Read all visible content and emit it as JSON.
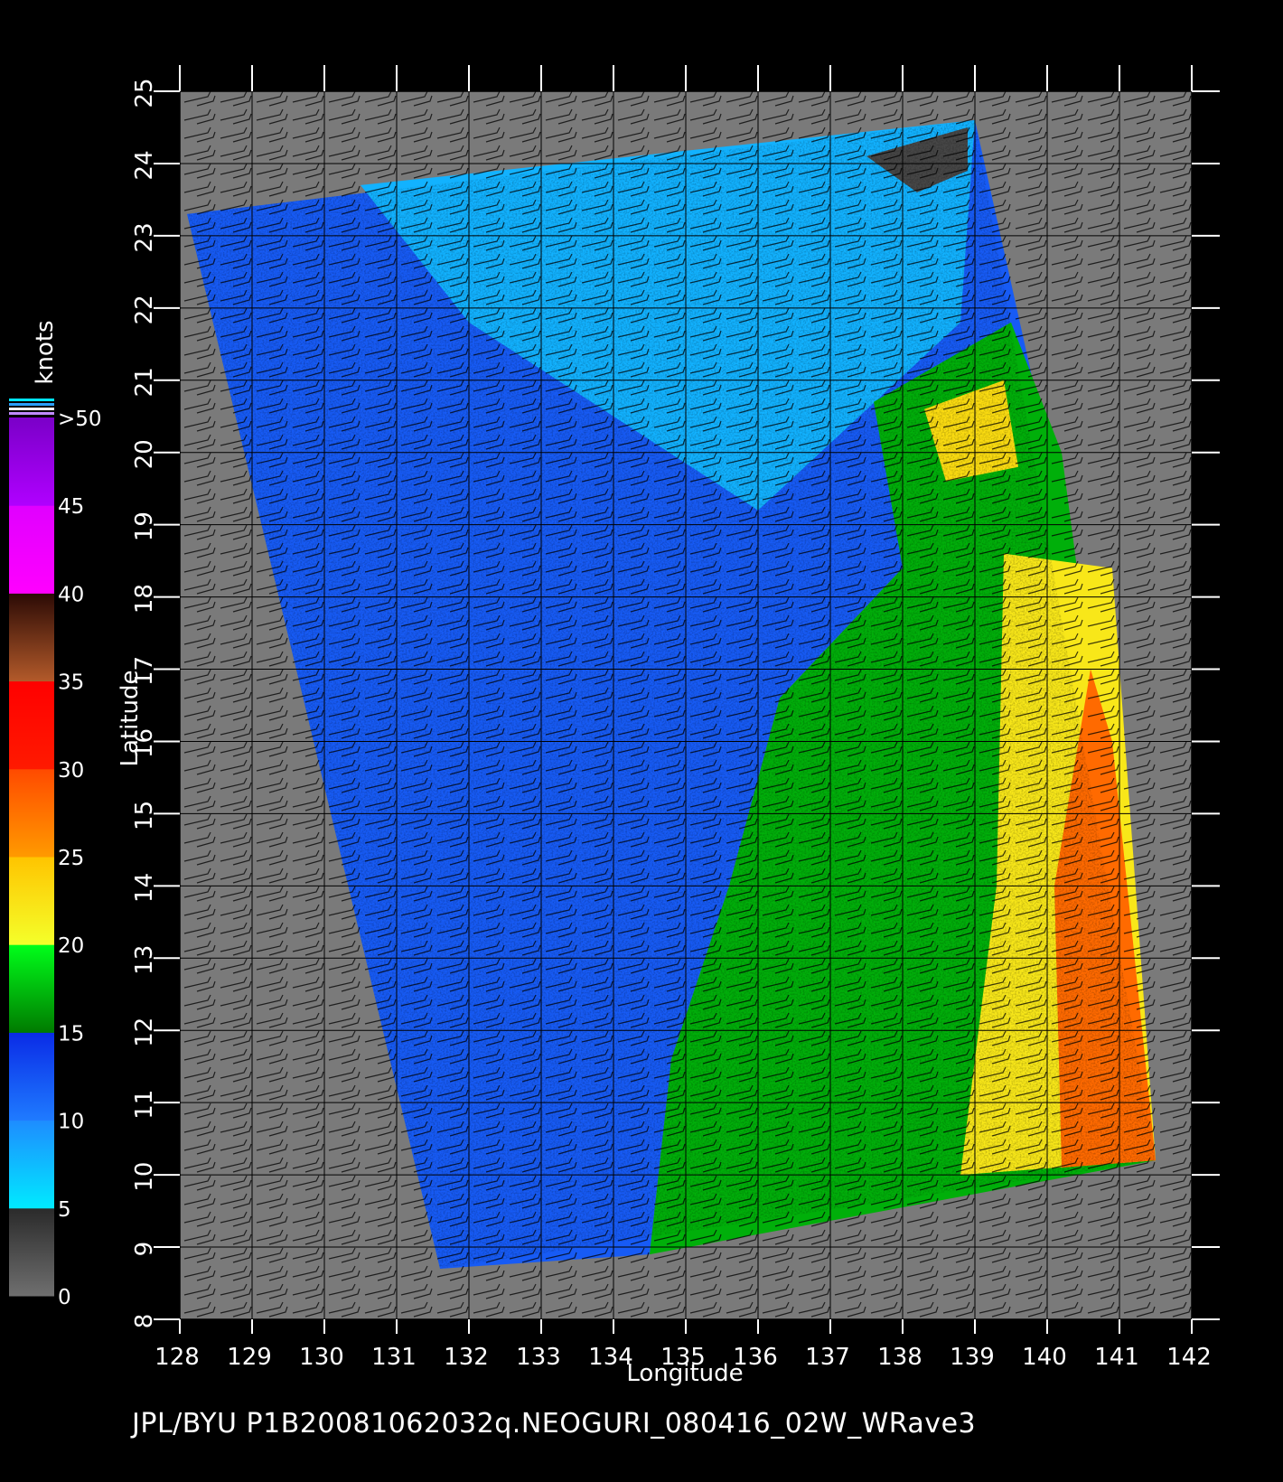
{
  "chart_data": {
    "type": "heatmap",
    "title": "",
    "caption": "JPL/BYU  P1B20081062032q.NEOGURI_080416_02W_WRave3",
    "xlabel": "Longitude",
    "ylabel": "Latitude",
    "xlim": [
      128,
      142
    ],
    "ylim": [
      8,
      25
    ],
    "x_ticks": [
      "128",
      "129",
      "130",
      "131",
      "132",
      "133",
      "134",
      "135",
      "136",
      "137",
      "138",
      "139",
      "140",
      "141",
      "142"
    ],
    "y_ticks": [
      "8",
      "9",
      "10",
      "11",
      "12",
      "13",
      "14",
      "15",
      "16",
      "17",
      "18",
      "19",
      "20",
      "21",
      "22",
      "23",
      "24",
      "25"
    ],
    "grid": true,
    "legend": "colorbar-left",
    "colorbar": {
      "title": "knots",
      "labels": [
        "0",
        "5",
        "10",
        "15",
        "20",
        "25",
        "30",
        "35",
        "40",
        "45",
        ">50"
      ],
      "bins": [
        {
          "range": [
            0,
            5
          ],
          "colors": [
            "#6f6f6f",
            "#2a2a2a"
          ]
        },
        {
          "range": [
            5,
            10
          ],
          "colors": [
            "#00eaff",
            "#1e8cff"
          ]
        },
        {
          "range": [
            10,
            15
          ],
          "colors": [
            "#1f7bff",
            "#0a2be6"
          ]
        },
        {
          "range": [
            15,
            20
          ],
          "colors": [
            "#007a00",
            "#00ff1a"
          ]
        },
        {
          "range": [
            20,
            25
          ],
          "colors": [
            "#f4ff2a",
            "#ffc400"
          ]
        },
        {
          "range": [
            25,
            30
          ],
          "colors": [
            "#ff9a00",
            "#ff4a00"
          ]
        },
        {
          "range": [
            30,
            35
          ],
          "colors": [
            "#ff1a00",
            "#ff0000"
          ]
        },
        {
          "range": [
            35,
            40
          ],
          "colors": [
            "#b35a2a",
            "#2b0a05"
          ]
        },
        {
          "range": [
            40,
            45
          ],
          "colors": [
            "#ff00ff",
            "#e000ff"
          ]
        },
        {
          "range": [
            45,
            50
          ],
          "colors": [
            "#b000ff",
            "#7a00c8"
          ]
        }
      ]
    },
    "swath_corners_lonlat": [
      [
        128.1,
        23.3
      ],
      [
        139.0,
        24.6
      ],
      [
        141.5,
        10.2
      ],
      [
        131.6,
        8.7
      ]
    ],
    "wind_speed_regions": [
      {
        "speed_knots": 12,
        "region": "western and central swath",
        "polygon_lonlat": [
          [
            128.1,
            23.3
          ],
          [
            139.0,
            24.6
          ],
          [
            139.8,
            21.0
          ],
          [
            138.0,
            18.4
          ],
          [
            136.3,
            16.6
          ],
          [
            135.6,
            14.0
          ],
          [
            134.8,
            11.6
          ],
          [
            134.5,
            8.9
          ],
          [
            131.6,
            8.7
          ]
        ]
      },
      {
        "speed_knots": 8,
        "region": "northern swath lighter blue",
        "polygon_lonlat": [
          [
            130.5,
            23.7
          ],
          [
            139.0,
            24.6
          ],
          [
            138.8,
            21.8
          ],
          [
            136.0,
            19.2
          ],
          [
            132.0,
            21.8
          ]
        ]
      },
      {
        "speed_knots": 17,
        "region": "eastern green band",
        "polygon_lonlat": [
          [
            137.6,
            20.7
          ],
          [
            139.5,
            21.8
          ],
          [
            140.2,
            20.0
          ],
          [
            141.5,
            10.2
          ],
          [
            134.5,
            8.9
          ],
          [
            134.8,
            11.6
          ],
          [
            135.6,
            14.0
          ],
          [
            136.3,
            16.6
          ],
          [
            138.0,
            18.4
          ]
        ]
      },
      {
        "speed_knots": 22,
        "region": "yellow band",
        "polygon_lonlat": [
          [
            139.4,
            18.6
          ],
          [
            140.9,
            18.4
          ],
          [
            141.5,
            10.2
          ],
          [
            138.8,
            10.0
          ],
          [
            139.3,
            14.0
          ]
        ]
      },
      {
        "speed_knots": 28,
        "region": "orange-red band",
        "polygon_lonlat": [
          [
            140.6,
            17.0
          ],
          [
            140.9,
            16.0
          ],
          [
            141.5,
            10.2
          ],
          [
            140.2,
            10.1
          ],
          [
            140.1,
            14.0
          ]
        ]
      },
      {
        "speed_knots": 23,
        "region": "yellow patch near 20N",
        "polygon_lonlat": [
          [
            138.3,
            20.6
          ],
          [
            139.4,
            21.0
          ],
          [
            139.6,
            19.8
          ],
          [
            138.6,
            19.6
          ]
        ]
      },
      {
        "speed_knots": 3,
        "region": "dark gray low-wind patch near 24N",
        "polygon_lonlat": [
          [
            137.5,
            24.1
          ],
          [
            138.9,
            24.5
          ],
          [
            138.9,
            23.9
          ],
          [
            138.2,
            23.6
          ]
        ]
      }
    ]
  }
}
